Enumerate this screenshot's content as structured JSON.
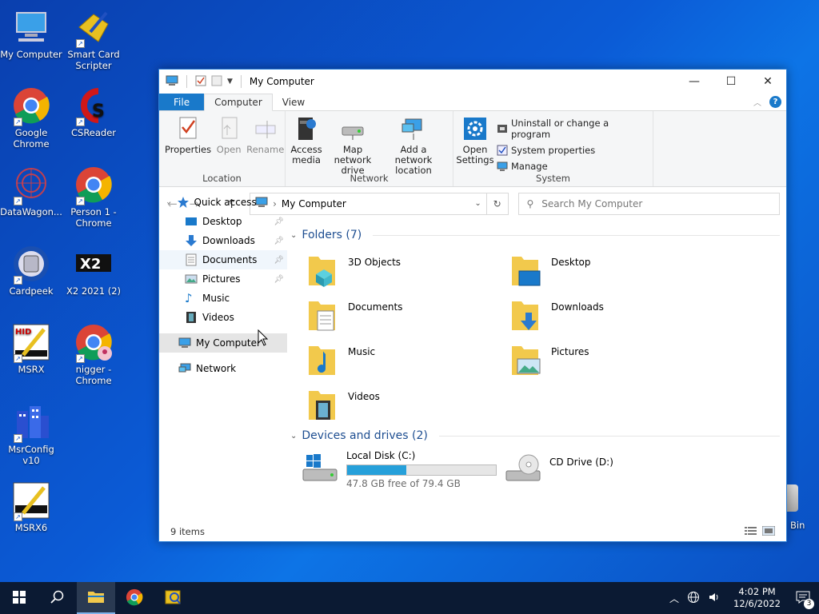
{
  "desktop": {
    "icons": [
      {
        "label": "My Computer"
      },
      {
        "label": "Smart Card Scripter"
      },
      {
        "label": "Google Chrome"
      },
      {
        "label": "CSReader"
      },
      {
        "label": "DataWagon..."
      },
      {
        "label": "Person 1 - Chrome"
      },
      {
        "label": "Cardpeek"
      },
      {
        "label": "X2 2021 (2)"
      },
      {
        "label": "MSRX"
      },
      {
        "label": "nigger - Chrome"
      },
      {
        "label": "MsrConfig v10"
      },
      {
        "label": "MSRX6"
      }
    ],
    "recycle_bin_partial": "Bin"
  },
  "window": {
    "title": "My Computer",
    "tabs": {
      "file": "File",
      "computer": "Computer",
      "view": "View"
    },
    "ribbon": {
      "location": {
        "label": "Location",
        "properties": "Properties",
        "open": "Open",
        "rename": "Rename"
      },
      "network": {
        "label": "Network",
        "access_media": "Access media",
        "map_drive": "Map network drive",
        "add_location": "Add a network location"
      },
      "system": {
        "label": "System",
        "open_settings": "Open Settings",
        "uninstall": "Uninstall or change a program",
        "system_properties": "System properties",
        "manage": "Manage"
      }
    },
    "address": {
      "path": "My Computer",
      "search_placeholder": "Search My Computer"
    },
    "nav": {
      "quick_access": "Quick access",
      "items": [
        "Desktop",
        "Downloads",
        "Documents",
        "Pictures",
        "Music",
        "Videos"
      ],
      "this_pc": "My Computer",
      "network": "Network"
    },
    "folders_header": "Folders (7)",
    "folders": [
      "3D Objects",
      "Desktop",
      "Documents",
      "Downloads",
      "Music",
      "Pictures",
      "Videos"
    ],
    "devices_header": "Devices and drives (2)",
    "drives": {
      "c": {
        "name": "Local Disk (C:)",
        "free": "47.8 GB free of 79.4 GB",
        "used_fraction": 0.398
      },
      "d": {
        "name": "CD Drive (D:)"
      }
    },
    "status": "9 items"
  },
  "taskbar": {
    "time": "4:02 PM",
    "date": "12/6/2022",
    "notifications": "3"
  }
}
